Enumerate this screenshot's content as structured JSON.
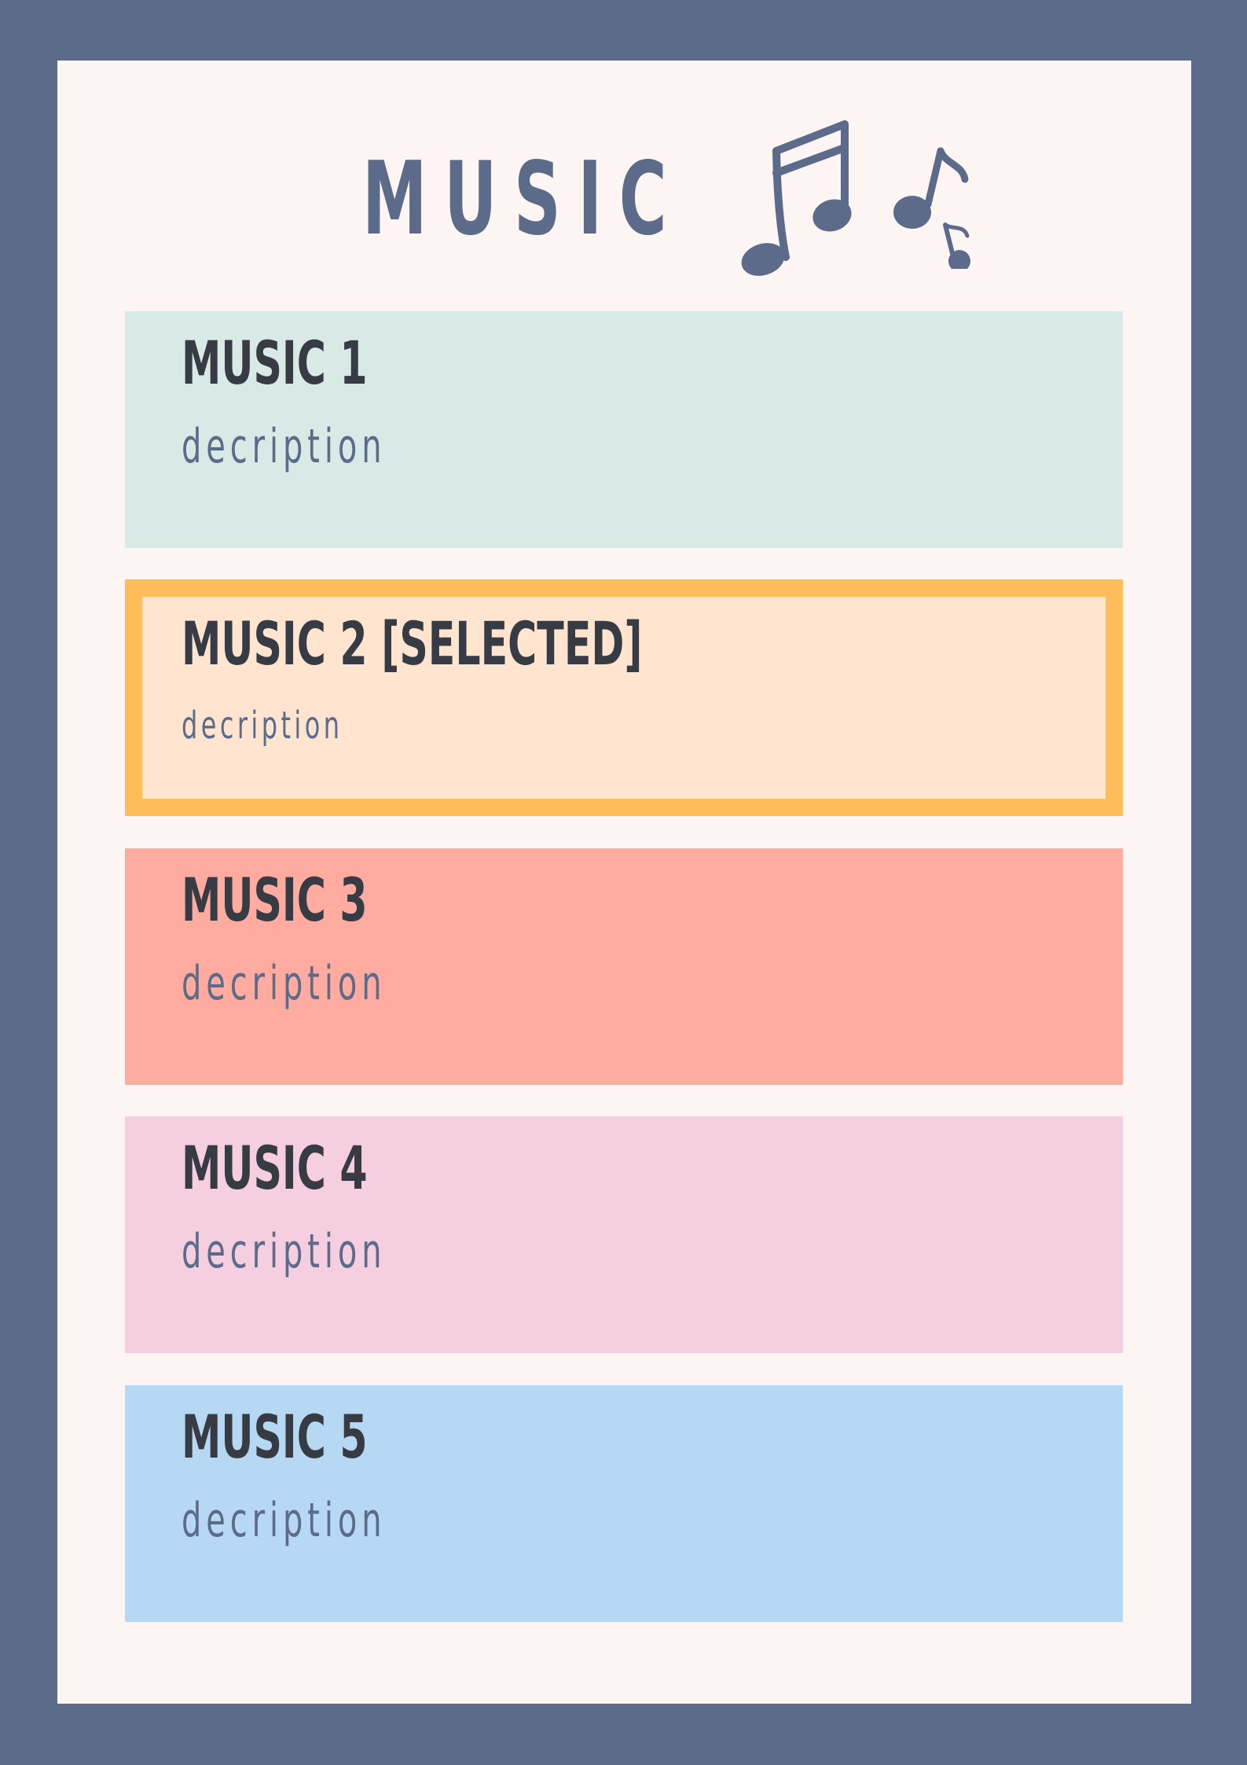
{
  "page": {
    "title": "MUSIC"
  },
  "icons": {
    "header_beamed": "beamed-eighth-notes-icon",
    "header_single": "eighth-note-icon"
  },
  "colors": {
    "frame": "#5c6b8a",
    "card": "#fcf5f3",
    "selected_border": "#ffbd59",
    "title_text": "#363b44",
    "desc_text": "#5c6b8a"
  },
  "items": [
    {
      "title": "MUSIC 1",
      "description": "decription",
      "color": "#d9eae6",
      "selected": false
    },
    {
      "title": "MUSIC 2  [SELECTED]",
      "description": "decription",
      "color": "#ffe5cf",
      "selected": true
    },
    {
      "title": "MUSIC 3",
      "description": "decription",
      "color": "#ffaba0",
      "selected": false
    },
    {
      "title": "MUSIC 4",
      "description": "decription",
      "color": "#f5cfe0",
      "selected": false
    },
    {
      "title": "MUSIC  5",
      "description": "decription",
      "color": "#b6d8f2",
      "selected": false
    }
  ]
}
